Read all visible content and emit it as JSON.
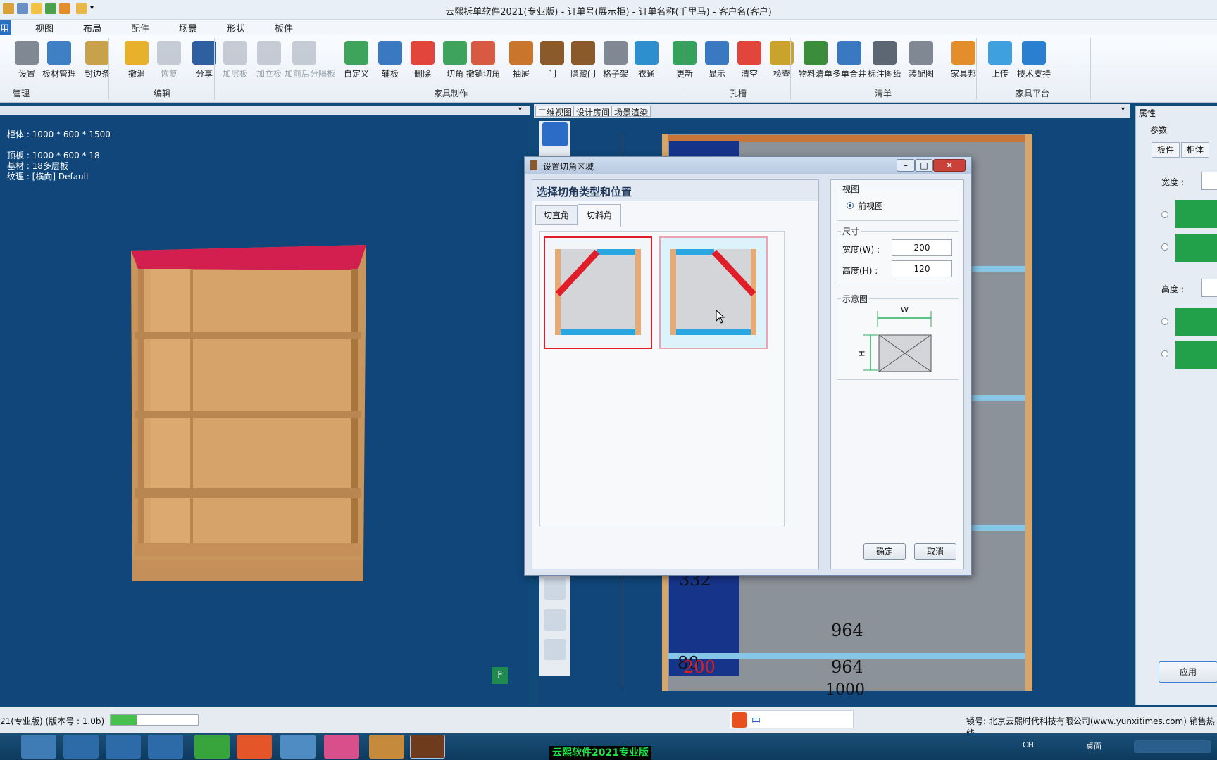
{
  "window": {
    "title": "云熙拆单软件2021(专业版) - 订单号(展示柜) - 订单名称(千里马) - 客户名(客户)"
  },
  "menu": {
    "tabs": [
      "用",
      "视图",
      "布局",
      "配件",
      "场景",
      "形状",
      "板件"
    ]
  },
  "ribbon": {
    "buttons": [
      {
        "label": "设置",
        "icon": "gear-icon"
      },
      {
        "label": "板材管理",
        "icon": "panel-stack-icon"
      },
      {
        "label": "封边条",
        "icon": "edge-band-icon"
      },
      {
        "label": "撤消",
        "icon": "undo-icon"
      },
      {
        "label": "恢复",
        "icon": "redo-icon"
      },
      {
        "label": "分享",
        "icon": "share-icon"
      },
      {
        "label": "加层板",
        "icon": "add-shelf-icon"
      },
      {
        "label": "加立板",
        "icon": "add-upright-icon"
      },
      {
        "label": "加前后分隔板",
        "icon": "add-divider-icon"
      },
      {
        "label": "自定义",
        "icon": "custom-icon"
      },
      {
        "label": "辅板",
        "icon": "aux-panel-icon"
      },
      {
        "label": "删除",
        "icon": "delete-icon"
      },
      {
        "label": "切角",
        "icon": "cut-corner-icon"
      },
      {
        "label": "撤销切角",
        "icon": "undo-cut-corner-icon"
      },
      {
        "label": "抽屉",
        "icon": "drawer-icon"
      },
      {
        "label": "门",
        "icon": "door-icon"
      },
      {
        "label": "隐藏门",
        "icon": "hide-door-icon"
      },
      {
        "label": "格子架",
        "icon": "grid-rack-icon"
      },
      {
        "label": "衣通",
        "icon": "hanger-rail-icon"
      },
      {
        "label": "更新",
        "icon": "update-icon"
      },
      {
        "label": "显示",
        "icon": "show-icon"
      },
      {
        "label": "清空",
        "icon": "clear-icon"
      },
      {
        "label": "检查",
        "icon": "check-icon"
      },
      {
        "label": "物料清单",
        "icon": "material-list-icon"
      },
      {
        "label": "多单合并",
        "icon": "merge-icon"
      },
      {
        "label": "标注图纸",
        "icon": "dwg-icon"
      },
      {
        "label": "装配图",
        "icon": "assembly-icon"
      },
      {
        "label": "家具邦",
        "icon": "furniture-home-icon"
      },
      {
        "label": "上传",
        "icon": "upload-icon"
      },
      {
        "label": "技术支持",
        "icon": "help-icon"
      }
    ],
    "groups": [
      "管理",
      "编辑",
      "家具制作",
      "孔槽",
      "清单",
      "家具平台"
    ]
  },
  "left_panel": {
    "cabinet": "柜体 : 1000 * 600 * 1500",
    "top_panel": "顶板 : 1000 * 600 * 18",
    "material": "基材 : 18多层板",
    "grain": "纹理 : [横向] Default",
    "view_badge": "F"
  },
  "right_panel": {
    "tabs": [
      "二维视图",
      "设计房间",
      "场景渲染"
    ],
    "dims": [
      "332",
      "964",
      "80",
      "200",
      "964",
      "1000"
    ]
  },
  "dialog": {
    "title": "设置切角区域",
    "heading": "选择切角类型和位置",
    "tabs": [
      "切直角",
      "切斜角"
    ],
    "active_tab": "切斜角",
    "view_group": "视图",
    "view_option": "前视图",
    "size_group": "尺寸",
    "width_label": "宽度(W) :",
    "width_value": "200",
    "height_label": "高度(H) :",
    "height_value": "120",
    "diagram_group": "示意图",
    "diagram_w": "W",
    "diagram_h": "H",
    "ok": "确定",
    "cancel": "取消"
  },
  "properties": {
    "title": "属性",
    "params": "参数",
    "tabs": [
      "板件",
      "柜体"
    ],
    "width_label": "宽度 :",
    "height_label": "高度 :",
    "apply": "应用"
  },
  "status": {
    "version": "21(专业版) (版本号 : 1.0b)",
    "license": "锁号: 北京云熙时代科技有限公司(www.yunxitimes.com) 销售热线"
  },
  "taskbar": {
    "active_app": "云熙软件2021专业版",
    "ime": "中",
    "lang": "CH",
    "desktop": "桌面"
  }
}
